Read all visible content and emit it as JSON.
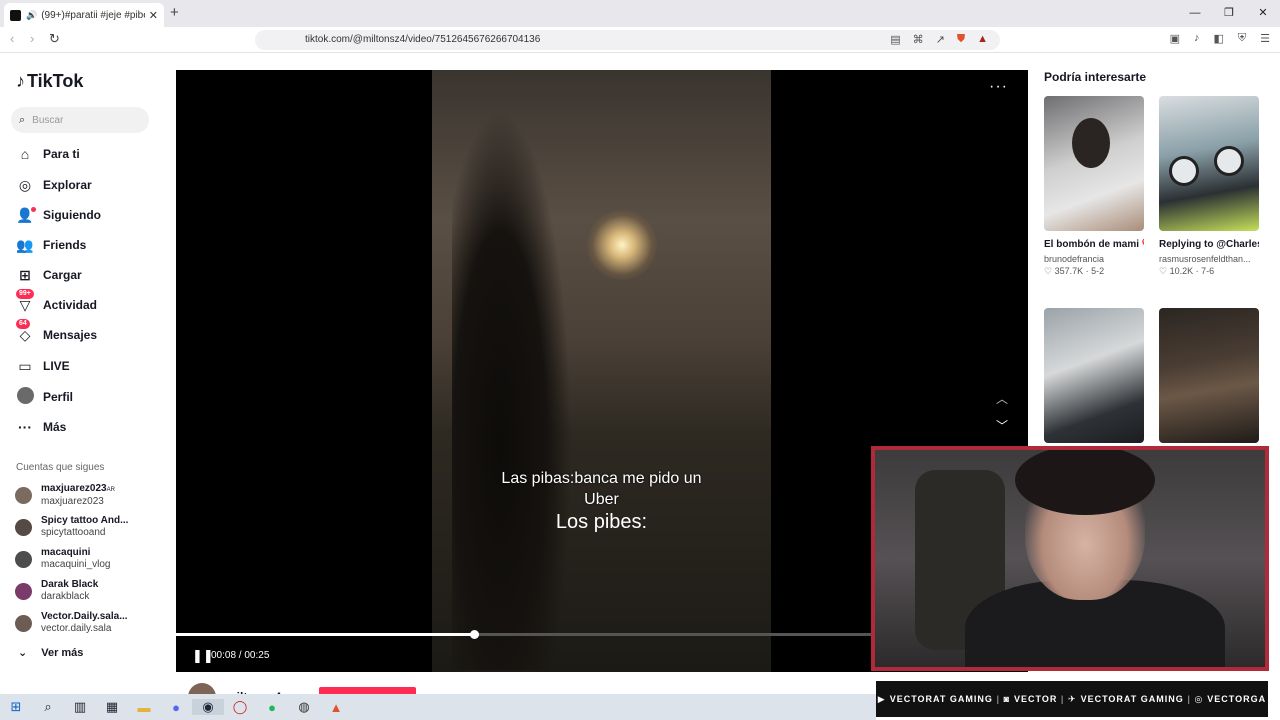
{
  "browser": {
    "tab_title": "(99+)#paratii #jeje #pibes #p",
    "url": "tiktok.com/@miltonsz4/video/7512645676266704136"
  },
  "sidebar": {
    "logo": "TikTok",
    "search_placeholder": "Buscar",
    "nav": [
      {
        "label": "Para ti",
        "icon": "home-icon"
      },
      {
        "label": "Explorar",
        "icon": "compass-icon"
      },
      {
        "label": "Siguiendo",
        "icon": "following-icon"
      },
      {
        "label": "Friends",
        "icon": "friends-icon"
      },
      {
        "label": "Cargar",
        "icon": "upload-icon"
      },
      {
        "label": "Actividad",
        "icon": "activity-icon",
        "badge": "99+"
      },
      {
        "label": "Mensajes",
        "icon": "messages-icon",
        "badge": "64"
      },
      {
        "label": "LIVE",
        "icon": "live-icon"
      },
      {
        "label": "Perfil",
        "icon": "profile-icon"
      },
      {
        "label": "Más",
        "icon": "more-icon"
      }
    ],
    "following_title": "Cuentas que sigues",
    "following": [
      {
        "name": "maxjuarez023",
        "tag": "AR",
        "handle": "maxjuarez023"
      },
      {
        "name": "Spicy tattoo And...",
        "tag": "",
        "handle": "spicytattooand"
      },
      {
        "name": "macaquini",
        "tag": "",
        "handle": "macaquini_vlog"
      },
      {
        "name": "Darak Black",
        "tag": "",
        "handle": "darakblack"
      },
      {
        "name": "Vector.Daily.sala...",
        "tag": "",
        "handle": "vector.daily.sala"
      }
    ],
    "ver_mas": "Ver más"
  },
  "video": {
    "caption_line1": "Las pibas:banca me pido un",
    "caption_line2": "Uber",
    "caption_line3": "Los pibes:",
    "time": "00:08 / 00:25",
    "progress": 0.35,
    "author": "miltonsz4"
  },
  "recommend": {
    "title": "Podría interesarte",
    "cards": [
      {
        "title": "El bombón de mami ❤️#blueandtan...",
        "user": "brunodefrancia",
        "likes": "357.7K",
        "date": "5-2"
      },
      {
        "title": "Replying to @Charles Jones...",
        "user": "rasmusrosenfeldthan...",
        "likes": "10.2K",
        "date": "7-6"
      },
      {
        "title": "",
        "user": "",
        "likes": "",
        "date": ""
      },
      {
        "title": "",
        "user": "",
        "likes": "",
        "date": ""
      }
    ]
  },
  "overlay": {
    "socials": [
      "VECTORAT GAMING",
      "VECTOR",
      "VECTORAT GAMING",
      "VECTORGA"
    ]
  }
}
